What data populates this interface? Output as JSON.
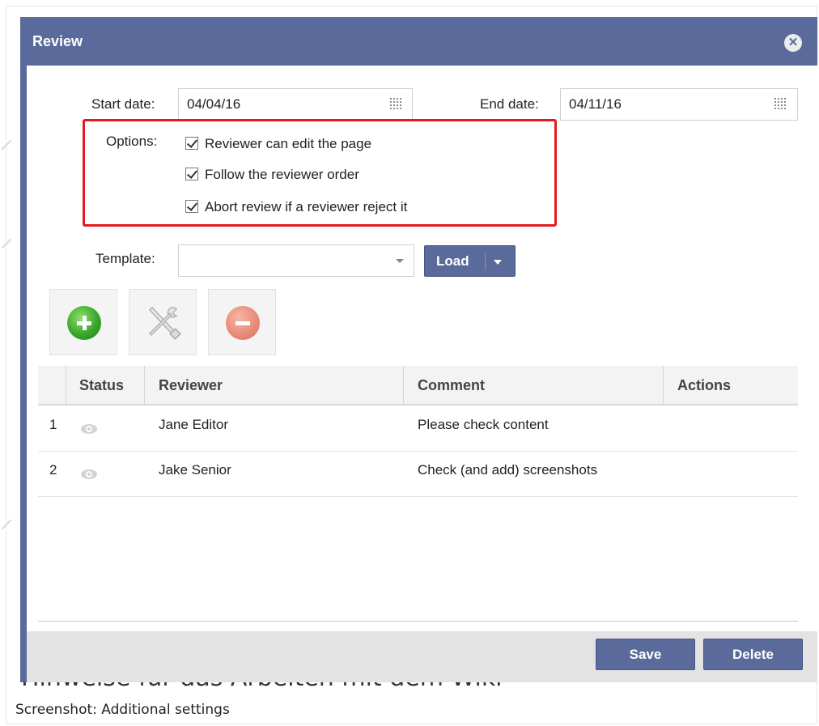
{
  "dialog": {
    "title": "Review"
  },
  "form": {
    "start_date_label": "Start date:",
    "start_date_value": "04/04/16",
    "end_date_label": "End date:",
    "end_date_value": "04/11/16",
    "options_label": "Options:",
    "options": [
      {
        "label": "Reviewer can edit the page",
        "checked": true
      },
      {
        "label": "Follow the reviewer order",
        "checked": true
      },
      {
        "label": "Abort review if a reviewer reject it",
        "checked": true
      }
    ],
    "template_label": "Template:",
    "template_value": "",
    "load_label": "Load"
  },
  "toolbar": {
    "add_icon": "plus-circle-icon",
    "edit_icon": "wrench-screwdriver-icon",
    "remove_icon": "minus-circle-icon"
  },
  "grid": {
    "columns": [
      "Status",
      "Reviewer",
      "Comment",
      "Actions"
    ],
    "rows": [
      {
        "index": "1",
        "status_icon": "eye-icon",
        "reviewer": "Jane Editor",
        "comment": "Please check content"
      },
      {
        "index": "2",
        "status_icon": "eye-icon",
        "reviewer": "Jake Senior",
        "comment": "Check (and add) screenshots"
      }
    ]
  },
  "footer": {
    "save_label": "Save",
    "delete_label": "Delete"
  },
  "background": {
    "partial_heading": "Hinweise für das Arbeiten mit dem Wiki"
  },
  "caption": "Screenshot: Additional settings",
  "colors": {
    "accent": "#5a6a9b",
    "highlight_border": "#e21a22",
    "add_green": "#3aa52c",
    "remove_red": "#e88c7a"
  }
}
